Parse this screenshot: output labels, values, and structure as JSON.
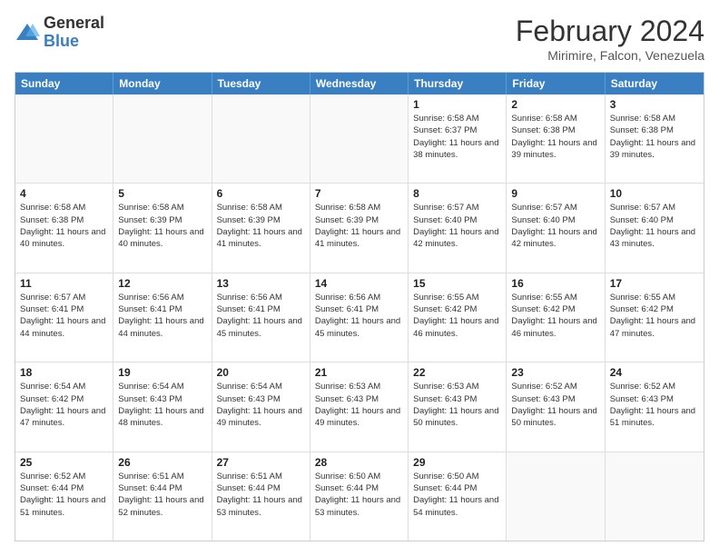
{
  "header": {
    "logo_general": "General",
    "logo_blue": "Blue",
    "title": "February 2024",
    "location": "Mirimire, Falcon, Venezuela"
  },
  "days_of_week": [
    "Sunday",
    "Monday",
    "Tuesday",
    "Wednesday",
    "Thursday",
    "Friday",
    "Saturday"
  ],
  "weeks": [
    [
      {
        "day": "",
        "info": ""
      },
      {
        "day": "",
        "info": ""
      },
      {
        "day": "",
        "info": ""
      },
      {
        "day": "",
        "info": ""
      },
      {
        "day": "1",
        "info": "Sunrise: 6:58 AM\nSunset: 6:37 PM\nDaylight: 11 hours\nand 38 minutes."
      },
      {
        "day": "2",
        "info": "Sunrise: 6:58 AM\nSunset: 6:38 PM\nDaylight: 11 hours\nand 39 minutes."
      },
      {
        "day": "3",
        "info": "Sunrise: 6:58 AM\nSunset: 6:38 PM\nDaylight: 11 hours\nand 39 minutes."
      }
    ],
    [
      {
        "day": "4",
        "info": "Sunrise: 6:58 AM\nSunset: 6:38 PM\nDaylight: 11 hours\nand 40 minutes."
      },
      {
        "day": "5",
        "info": "Sunrise: 6:58 AM\nSunset: 6:39 PM\nDaylight: 11 hours\nand 40 minutes."
      },
      {
        "day": "6",
        "info": "Sunrise: 6:58 AM\nSunset: 6:39 PM\nDaylight: 11 hours\nand 41 minutes."
      },
      {
        "day": "7",
        "info": "Sunrise: 6:58 AM\nSunset: 6:39 PM\nDaylight: 11 hours\nand 41 minutes."
      },
      {
        "day": "8",
        "info": "Sunrise: 6:57 AM\nSunset: 6:40 PM\nDaylight: 11 hours\nand 42 minutes."
      },
      {
        "day": "9",
        "info": "Sunrise: 6:57 AM\nSunset: 6:40 PM\nDaylight: 11 hours\nand 42 minutes."
      },
      {
        "day": "10",
        "info": "Sunrise: 6:57 AM\nSunset: 6:40 PM\nDaylight: 11 hours\nand 43 minutes."
      }
    ],
    [
      {
        "day": "11",
        "info": "Sunrise: 6:57 AM\nSunset: 6:41 PM\nDaylight: 11 hours\nand 44 minutes."
      },
      {
        "day": "12",
        "info": "Sunrise: 6:56 AM\nSunset: 6:41 PM\nDaylight: 11 hours\nand 44 minutes."
      },
      {
        "day": "13",
        "info": "Sunrise: 6:56 AM\nSunset: 6:41 PM\nDaylight: 11 hours\nand 45 minutes."
      },
      {
        "day": "14",
        "info": "Sunrise: 6:56 AM\nSunset: 6:41 PM\nDaylight: 11 hours\nand 45 minutes."
      },
      {
        "day": "15",
        "info": "Sunrise: 6:55 AM\nSunset: 6:42 PM\nDaylight: 11 hours\nand 46 minutes."
      },
      {
        "day": "16",
        "info": "Sunrise: 6:55 AM\nSunset: 6:42 PM\nDaylight: 11 hours\nand 46 minutes."
      },
      {
        "day": "17",
        "info": "Sunrise: 6:55 AM\nSunset: 6:42 PM\nDaylight: 11 hours\nand 47 minutes."
      }
    ],
    [
      {
        "day": "18",
        "info": "Sunrise: 6:54 AM\nSunset: 6:42 PM\nDaylight: 11 hours\nand 47 minutes."
      },
      {
        "day": "19",
        "info": "Sunrise: 6:54 AM\nSunset: 6:43 PM\nDaylight: 11 hours\nand 48 minutes."
      },
      {
        "day": "20",
        "info": "Sunrise: 6:54 AM\nSunset: 6:43 PM\nDaylight: 11 hours\nand 49 minutes."
      },
      {
        "day": "21",
        "info": "Sunrise: 6:53 AM\nSunset: 6:43 PM\nDaylight: 11 hours\nand 49 minutes."
      },
      {
        "day": "22",
        "info": "Sunrise: 6:53 AM\nSunset: 6:43 PM\nDaylight: 11 hours\nand 50 minutes."
      },
      {
        "day": "23",
        "info": "Sunrise: 6:52 AM\nSunset: 6:43 PM\nDaylight: 11 hours\nand 50 minutes."
      },
      {
        "day": "24",
        "info": "Sunrise: 6:52 AM\nSunset: 6:43 PM\nDaylight: 11 hours\nand 51 minutes."
      }
    ],
    [
      {
        "day": "25",
        "info": "Sunrise: 6:52 AM\nSunset: 6:44 PM\nDaylight: 11 hours\nand 51 minutes."
      },
      {
        "day": "26",
        "info": "Sunrise: 6:51 AM\nSunset: 6:44 PM\nDaylight: 11 hours\nand 52 minutes."
      },
      {
        "day": "27",
        "info": "Sunrise: 6:51 AM\nSunset: 6:44 PM\nDaylight: 11 hours\nand 53 minutes."
      },
      {
        "day": "28",
        "info": "Sunrise: 6:50 AM\nSunset: 6:44 PM\nDaylight: 11 hours\nand 53 minutes."
      },
      {
        "day": "29",
        "info": "Sunrise: 6:50 AM\nSunset: 6:44 PM\nDaylight: 11 hours\nand 54 minutes."
      },
      {
        "day": "",
        "info": ""
      },
      {
        "day": "",
        "info": ""
      }
    ]
  ]
}
